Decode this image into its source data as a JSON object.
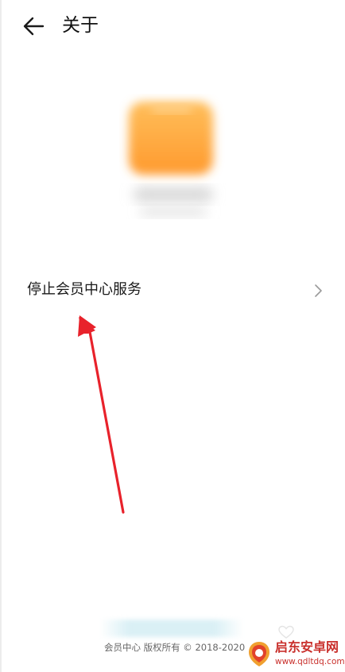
{
  "header": {
    "back_icon": "arrow-left-icon",
    "title": "关于"
  },
  "app_logo": {
    "description_icon": "app-logo-blurred",
    "color": "#ffa53a"
  },
  "menu": {
    "items": [
      {
        "label": "停止会员中心服务",
        "icon": "chevron-right-icon"
      }
    ]
  },
  "annotation": {
    "arrow_color": "#e8222b"
  },
  "footer": {
    "copyright": "会员中心 版权所有 © 2018-2020"
  },
  "watermark": {
    "name": "启东安卓网",
    "url": "www.qdltdq.com",
    "color": "#c9302c"
  }
}
